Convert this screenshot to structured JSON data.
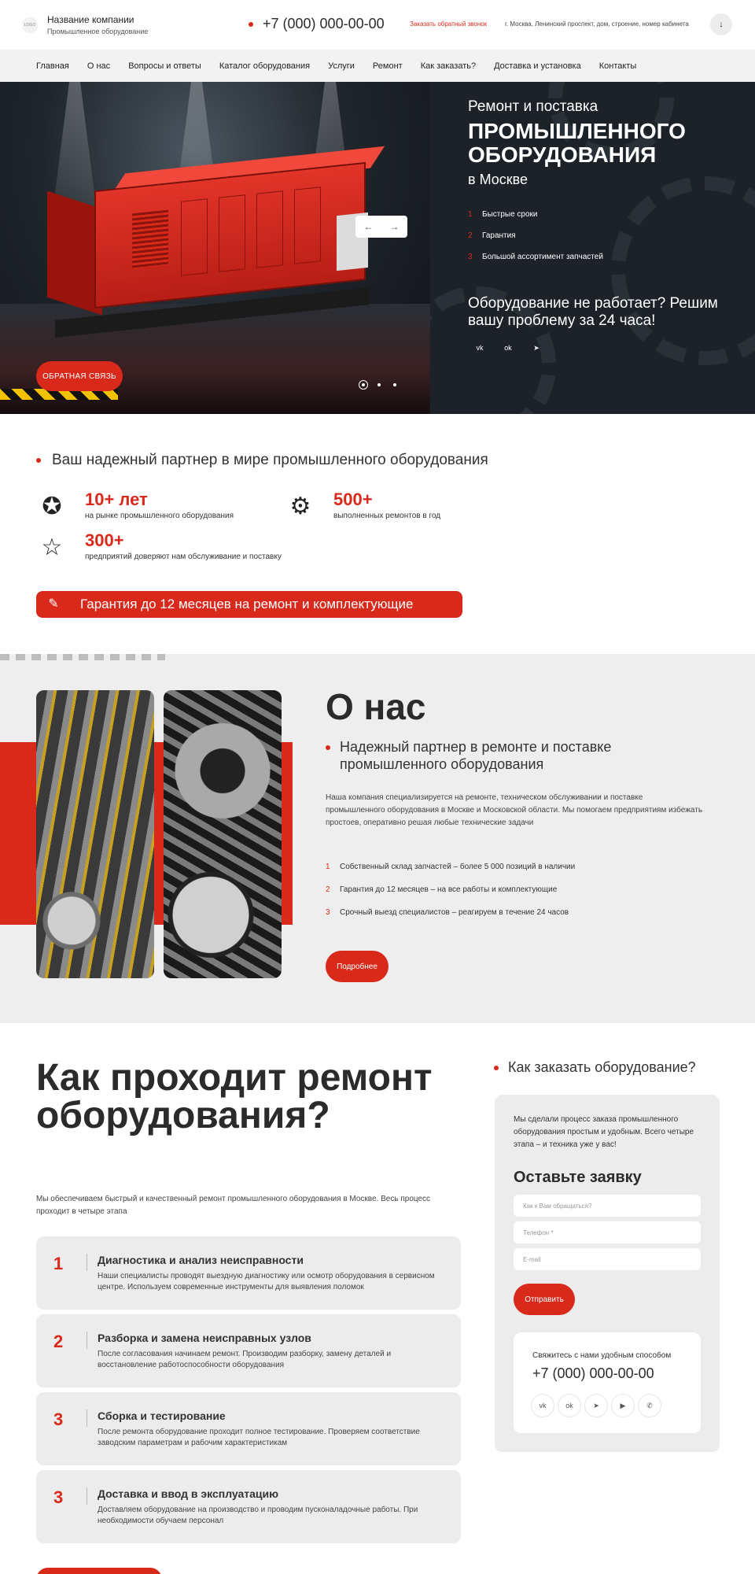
{
  "header": {
    "logo_text": "LOGO",
    "company_name": "Название компании",
    "company_sub": "Промышленное оборудование",
    "phone": "+7 (000) 000-00-00",
    "callback": "Заказать обратный звонок",
    "address": "г. Москва, Ленинский проспект, дом, строение, номер кабинета",
    "down_icon": "↓"
  },
  "nav": {
    "items": [
      "Главная",
      "О нас",
      "Вопросы и ответы",
      "Каталог оборудования",
      "Услуги",
      "Ремонт",
      "Как заказать?",
      "Доставка и установка",
      "Контакты"
    ]
  },
  "hero": {
    "line1": "Ремонт и поставка",
    "line2": "ПРОМЫШЛЕННОГО ОБОРУДОВАНИЯ",
    "line3": "в Москве",
    "features": [
      {
        "num": "1",
        "text": "Быстрые сроки"
      },
      {
        "num": "2",
        "text": "Гарантия"
      },
      {
        "num": "3",
        "text": "Большой ассортимент запчастей"
      }
    ],
    "problem": "Оборудование не работает? Решим вашу проблему за 24 часа!",
    "feedback_button": "ОБРАТНАЯ СВЯЗЬ",
    "arrow_prev": "←",
    "arrow_next": "→",
    "social": [
      "vk",
      "ok",
      "tg"
    ],
    "social_glyphs": [
      "vk",
      "ok",
      "➤"
    ]
  },
  "partner": {
    "title": "Ваш надежный партнер в мире промышленного оборудования",
    "stats": [
      {
        "value": "10+ лет",
        "desc": "на рынке промышленного оборудования",
        "icon": "award-badge-icon",
        "glyph": "✪"
      },
      {
        "value": "500+",
        "desc": "выполненных ремонтов в год",
        "icon": "gear-icon",
        "glyph": "⚙"
      },
      {
        "value": "300+",
        "desc": "предприятий доверяют нам обслуживание и поставку",
        "icon": "hand-star-icon",
        "glyph": "☆"
      }
    ],
    "guarantee_icon": "✎",
    "guarantee": "Гарантия до 12 месяцев на ремонт и комплектующие"
  },
  "about": {
    "title": "О нас",
    "subtitle": "Надежный партнер в ремонте и поставке промышленного оборудования",
    "paragraph": "Наша компания специализируется на ремонте, техническом обслуживании и поставке промышленного оборудования в Москве и Московской области. Мы помогаем предприятиям избежать простоев, оперативно решая любые технические задачи",
    "list": [
      {
        "num": "1",
        "text": "Собственный склад запчастей – более 5 000 позиций в наличии"
      },
      {
        "num": "2",
        "text": "Гарантия до 12 месяцев – на все работы и комплектующие"
      },
      {
        "num": "3",
        "text": "Срочный выезд специалистов – реагируем в течение 24 часов"
      }
    ],
    "more_button": "Подробнее"
  },
  "process": {
    "title": "Как проходит ремонт оборудования?",
    "intro": "Мы обеспечиваем быстрый и качественный ремонт промышленного оборудования в Москве. Весь процесс проходит в четыре этапа",
    "steps": [
      {
        "num": "1",
        "title": "Диагностика и анализ неисправности",
        "desc": "Наши специалисты проводят выездную диагностику или осмотр оборудования в сервисном центре. Используем современные инструменты для выявления поломок"
      },
      {
        "num": "2",
        "title": "Разборка и замена неисправных узлов",
        "desc": "После согласования начинаем ремонт. Производим разборку, замену деталей и восстановление работоспособности оборудования"
      },
      {
        "num": "3",
        "title": "Сборка и тестирование",
        "desc": "После ремонта оборудование проходит полное тестирование. Проверяем соответствие заводским параметрам и рабочим характеристикам"
      },
      {
        "num": "3",
        "title": "Доставка и ввод в эксплуатацию",
        "desc": "Доставляем оборудование на производство и проводим пусконаладочные работы. При необходимости обучаем персонал"
      }
    ]
  },
  "order": {
    "title": "Как заказать оборудование?",
    "intro": "Мы сделали процесс заказа промышленного оборудования простым и удобным. Всего четыре этапа – и техника уже у вас!",
    "form_title": "Оставьте заявку",
    "name_placeholder": "Как к Вам обращаться?",
    "phone_placeholder": "Телефон *",
    "email_placeholder": "E-mail",
    "send_button": "Отправить",
    "contact_label": "Свяжитесь с нами удобным способом",
    "contact_phone": "+7 (000) 000-00-00",
    "social": [
      "vk",
      "ok",
      "tg",
      "youtube",
      "whatsapp"
    ],
    "social_glyphs": [
      "vk",
      "ok",
      "➤",
      "▶",
      "✆"
    ]
  },
  "colors": {
    "accent": "#d8291b",
    "dark": "#1d2228",
    "light_bg": "#eeeeee"
  }
}
